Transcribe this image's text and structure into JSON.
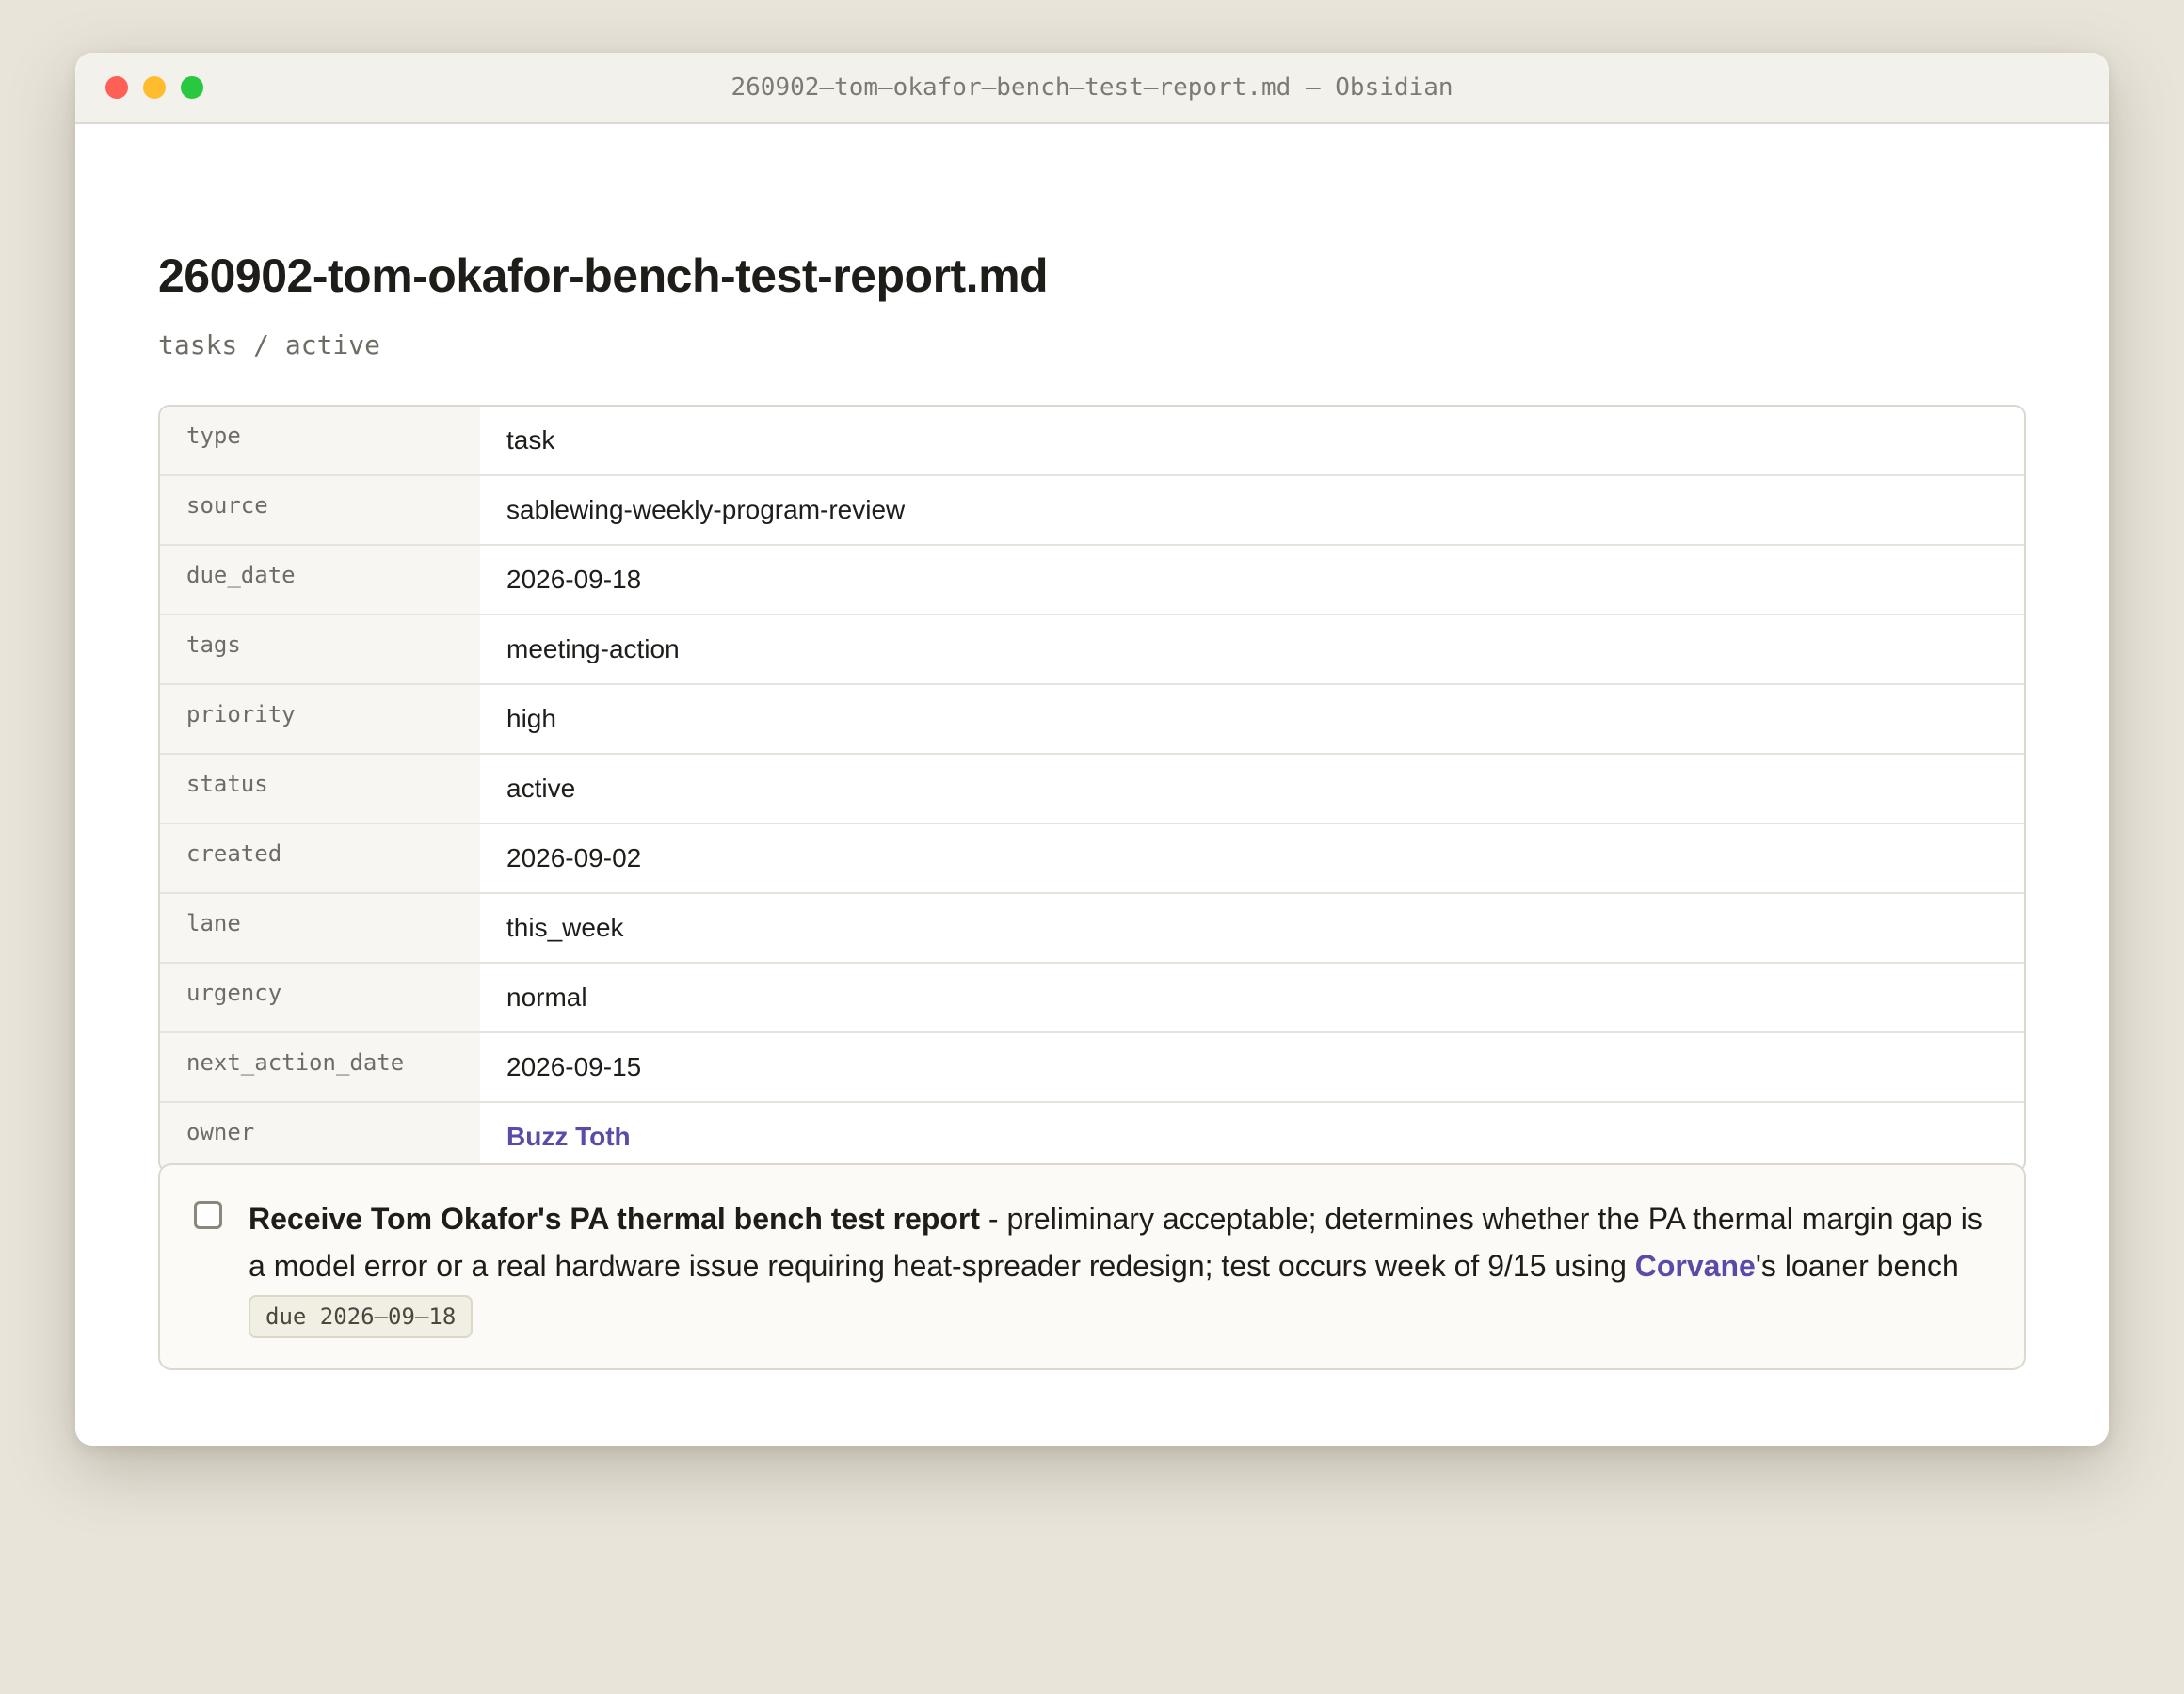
{
  "window": {
    "title": "260902–tom–okafor–bench–test–report.md — Obsidian"
  },
  "document": {
    "title": "260902-tom-okafor-bench-test-report.md",
    "breadcrumb": "tasks / active"
  },
  "properties": [
    {
      "key": "type",
      "value": "task"
    },
    {
      "key": "source",
      "value": "sablewing-weekly-program-review"
    },
    {
      "key": "due_date",
      "value": "2026-09-18"
    },
    {
      "key": "tags",
      "value": "meeting-action"
    },
    {
      "key": "priority",
      "value": "high"
    },
    {
      "key": "status",
      "value": "active"
    },
    {
      "key": "created",
      "value": "2026-09-02"
    },
    {
      "key": "lane",
      "value": "this_week"
    },
    {
      "key": "urgency",
      "value": "normal"
    },
    {
      "key": "next_action_date",
      "value": "2026-09-15"
    },
    {
      "key": "owner",
      "value": "Buzz Toth"
    }
  ],
  "task": {
    "checked": false,
    "title": "Receive Tom Okafor's PA thermal bench test report",
    "description_part1": " - preliminary acceptable; determines whether the PA thermal margin gap is a model error or a real hardware issue requiring heat-spreader redesign; test occurs week of 9/15 using ",
    "link_text": "Corvane",
    "description_part2": "'s loaner bench",
    "due_label": "due 2026–09–18"
  },
  "colors": {
    "link": "#5b4ba8",
    "close": "#fe5f57",
    "minimize": "#febc2e",
    "maximize": "#28c840"
  }
}
